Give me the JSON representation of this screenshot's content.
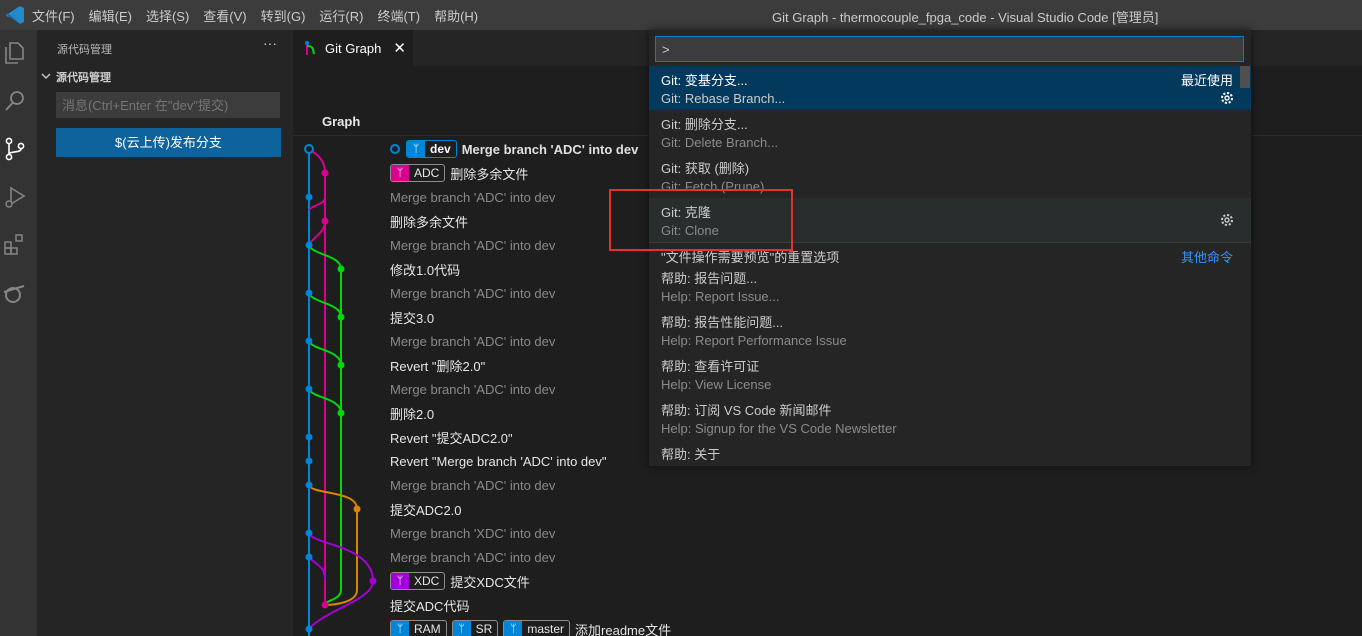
{
  "window": {
    "title": "Git Graph - thermocouple_fpga_code - Visual Studio Code [管理员]",
    "menu": [
      "文件(F)",
      "编辑(E)",
      "选择(S)",
      "查看(V)",
      "转到(G)",
      "运行(R)",
      "终端(T)",
      "帮助(H)"
    ]
  },
  "sidebar": {
    "title": "源代码管理",
    "more": "···",
    "section": "源代码管理",
    "message_placeholder": "消息(Ctrl+Enter 在\"dev\"提交)",
    "publish_button": "$(云上传)发布分支"
  },
  "tab": {
    "label": "Git Graph",
    "close": "✕"
  },
  "gitgraph": {
    "column_graph": "Graph",
    "rows": [
      {
        "refs": [
          {
            "name": "dev",
            "head": true,
            "color": "#0085d9"
          }
        ],
        "msg": "Merge branch 'ADC' into dev",
        "merge": false,
        "bold": true
      },
      {
        "refs": [
          {
            "name": "ADC",
            "head": false,
            "color": "#d9008f"
          }
        ],
        "msg": "删除多余文件",
        "merge": false
      },
      {
        "refs": [],
        "msg": "Merge branch 'ADC' into dev",
        "merge": true
      },
      {
        "refs": [],
        "msg": "删除多余文件",
        "merge": false
      },
      {
        "refs": [],
        "msg": "Merge branch 'ADC' into dev",
        "merge": true
      },
      {
        "refs": [],
        "msg": "修改1.0代码",
        "merge": false
      },
      {
        "refs": [],
        "msg": "Merge branch 'ADC' into dev",
        "merge": true
      },
      {
        "refs": [],
        "msg": "提交3.0",
        "merge": false
      },
      {
        "refs": [],
        "msg": "Merge branch 'ADC' into dev",
        "merge": true
      },
      {
        "refs": [],
        "msg": "Revert \"删除2.0\"",
        "merge": false
      },
      {
        "refs": [],
        "msg": "Merge branch 'ADC' into dev",
        "merge": true
      },
      {
        "refs": [],
        "msg": "删除2.0",
        "merge": false
      },
      {
        "refs": [],
        "msg": "Revert \"提交ADC2.0\"",
        "merge": false
      },
      {
        "refs": [],
        "msg": "Revert \"Merge branch 'ADC' into dev\"",
        "merge": false
      },
      {
        "refs": [],
        "msg": "Merge branch 'ADC' into dev",
        "merge": true
      },
      {
        "refs": [],
        "msg": "提交ADC2.0",
        "merge": false
      },
      {
        "refs": [],
        "msg": "Merge branch 'XDC' into dev",
        "merge": true
      },
      {
        "refs": [],
        "msg": "Merge branch 'ADC' into dev",
        "merge": true
      },
      {
        "refs": [
          {
            "name": "XDC",
            "head": false,
            "color": "#a300d9"
          }
        ],
        "msg": "提交XDC文件",
        "merge": false
      },
      {
        "refs": [],
        "msg": "提交ADC代码",
        "merge": false
      },
      {
        "refs": [
          {
            "name": "RAM",
            "head": false,
            "color": "#0085d9"
          },
          {
            "name": "SR",
            "head": false,
            "color": "#0085d9"
          },
          {
            "name": "master",
            "head": false,
            "color": "#0085d9"
          }
        ],
        "msg": "添加readme文件",
        "merge": false
      }
    ]
  },
  "palette": {
    "input_value": ">",
    "items": [
      {
        "label": "Git: 变基分支...",
        "sub": "Git: Rebase Branch...",
        "badge": "最近使用",
        "gear": true,
        "state": "selected"
      },
      {
        "label": "Git: 删除分支...",
        "sub": "Git: Delete Branch...",
        "state": "normal"
      },
      {
        "label": "Git: 获取 (删除)",
        "sub": "Git: Fetch (Prune)",
        "state": "normal"
      },
      {
        "label": "Git: 克隆",
        "sub": "Git: Clone",
        "gear": true,
        "state": "hover"
      },
      {
        "label": "\"文件操作需要预览\"的重置选项",
        "other": "其他命令",
        "state": "single"
      },
      {
        "label": "帮助: 报告问题...",
        "sub": "Help: Report Issue...",
        "state": "normal"
      },
      {
        "label": "帮助: 报告性能问题...",
        "sub": "Help: Report Performance Issue",
        "state": "normal"
      },
      {
        "label": "帮助: 查看许可证",
        "sub": "Help: View License",
        "state": "normal"
      },
      {
        "label": "帮助: 订阅 VS Code 新闻邮件",
        "sub": "Help: Signup for the VS Code Newsletter",
        "state": "normal"
      },
      {
        "label": "帮助: 关于",
        "state": "single"
      }
    ]
  },
  "colors": {
    "accent": "#0e639c",
    "branch_blue": "#0085d9",
    "branch_pink": "#d9008f",
    "branch_green": "#00d90a",
    "branch_orange": "#d98500",
    "branch_purple": "#a300d9",
    "highlight": "#e5332a"
  }
}
